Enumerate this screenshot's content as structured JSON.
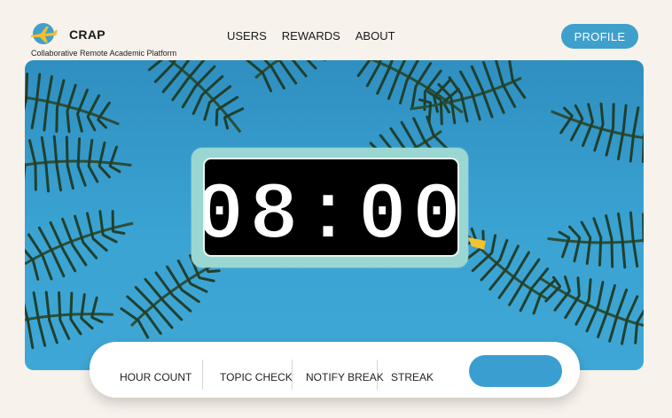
{
  "header": {
    "title": "CRAP",
    "subtitle": "Collaborative Remote Academic Platform",
    "logo_icon": "airplane-icon",
    "nav": [
      "USERS",
      "REWARDS",
      "ABOUT"
    ],
    "profile_label": "PROFILE"
  },
  "clock": {
    "time": "08:00"
  },
  "bottom_bar": {
    "items": [
      "HOUR COUNT",
      "TOPIC CHECK",
      "NOTIFY BREAK",
      "STREAK"
    ],
    "action_button_label": ""
  },
  "colors": {
    "accent": "#3fa0cc",
    "sky": "#3aa3d2",
    "clock_frame": "#9ad7d2",
    "background": "#f8f2ec"
  }
}
